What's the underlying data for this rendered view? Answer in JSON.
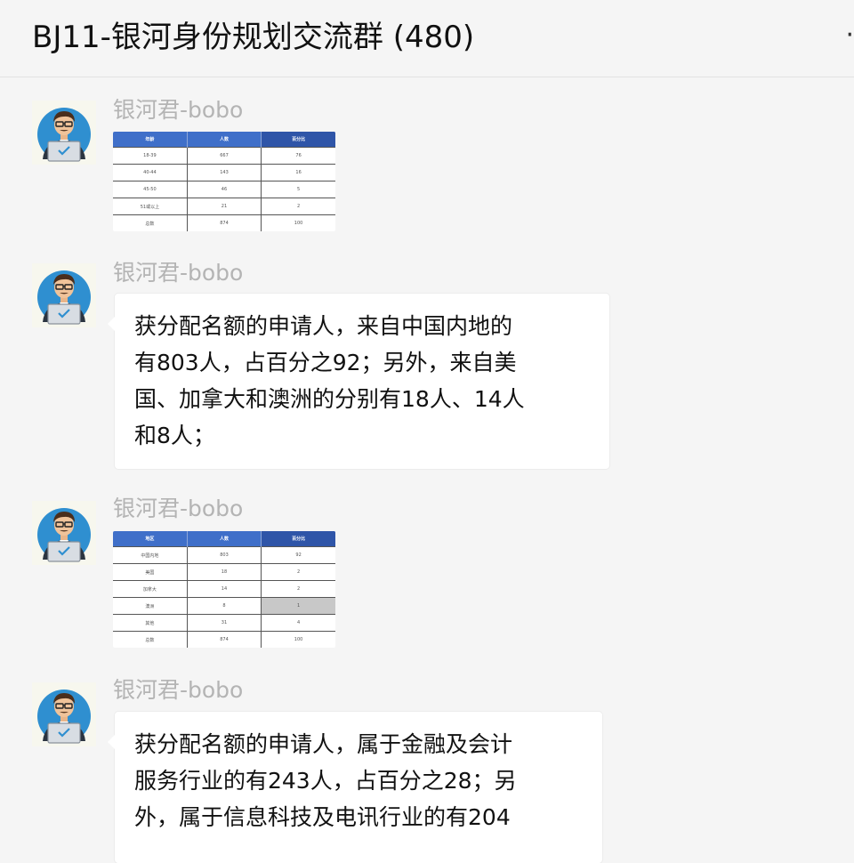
{
  "header": {
    "title": "BJ11-银河身份规划交流群 (480)",
    "more_icon": "more-icon",
    "more_glyph": "·"
  },
  "colors": {
    "background": "#f5f5f5",
    "bubble": "#ffffff",
    "sender_name": "#b4b4b4",
    "table_header_blue": "#3f6fc9",
    "table_header_dark_blue": "#2f55a8",
    "table_highlight_grey": "#c8c8c8"
  },
  "messages": [
    {
      "sender": "银河君-bobo",
      "avatar_icon": "businessman-laptop-avatar-icon",
      "type": "image-table",
      "table": {
        "headers": [
          "年龄",
          "人数",
          "百分比"
        ],
        "rows": [
          [
            "18-39",
            "667",
            "76"
          ],
          [
            "40-44",
            "143",
            "16"
          ],
          [
            "45-50",
            "46",
            "5"
          ],
          [
            "51或以上",
            "21",
            "2"
          ],
          [
            "总数",
            "874",
            "100"
          ]
        ],
        "highlight": []
      }
    },
    {
      "sender": "银河君-bobo",
      "avatar_icon": "businessman-laptop-avatar-icon",
      "type": "text",
      "lines": [
        "获分配名额的申请人，来自中国内地的",
        "有803人，占百分之92；另外，来自美",
        "国、加拿大和澳洲的分别有18人、14人",
        "和8人；"
      ]
    },
    {
      "sender": "银河君-bobo",
      "avatar_icon": "businessman-laptop-avatar-icon",
      "type": "image-table",
      "table": {
        "headers": [
          "地区",
          "人数",
          "百分比"
        ],
        "rows": [
          [
            "中国内地",
            "803",
            "92"
          ],
          [
            "美国",
            "18",
            "2"
          ],
          [
            "加拿大",
            "14",
            "2"
          ],
          [
            "澳洲",
            "8",
            "1"
          ],
          [
            "其他",
            "31",
            "4"
          ],
          [
            "总数",
            "874",
            "100"
          ]
        ],
        "highlight": [
          [
            3,
            2
          ]
        ]
      }
    },
    {
      "sender": "银河君-bobo",
      "avatar_icon": "businessman-laptop-avatar-icon",
      "type": "text",
      "lines": [
        "获分配名额的申请人，属于金融及会计",
        "服务行业的有243人，占百分之28；另",
        "外，属于信息科技及电讯行业的有204"
      ]
    }
  ]
}
